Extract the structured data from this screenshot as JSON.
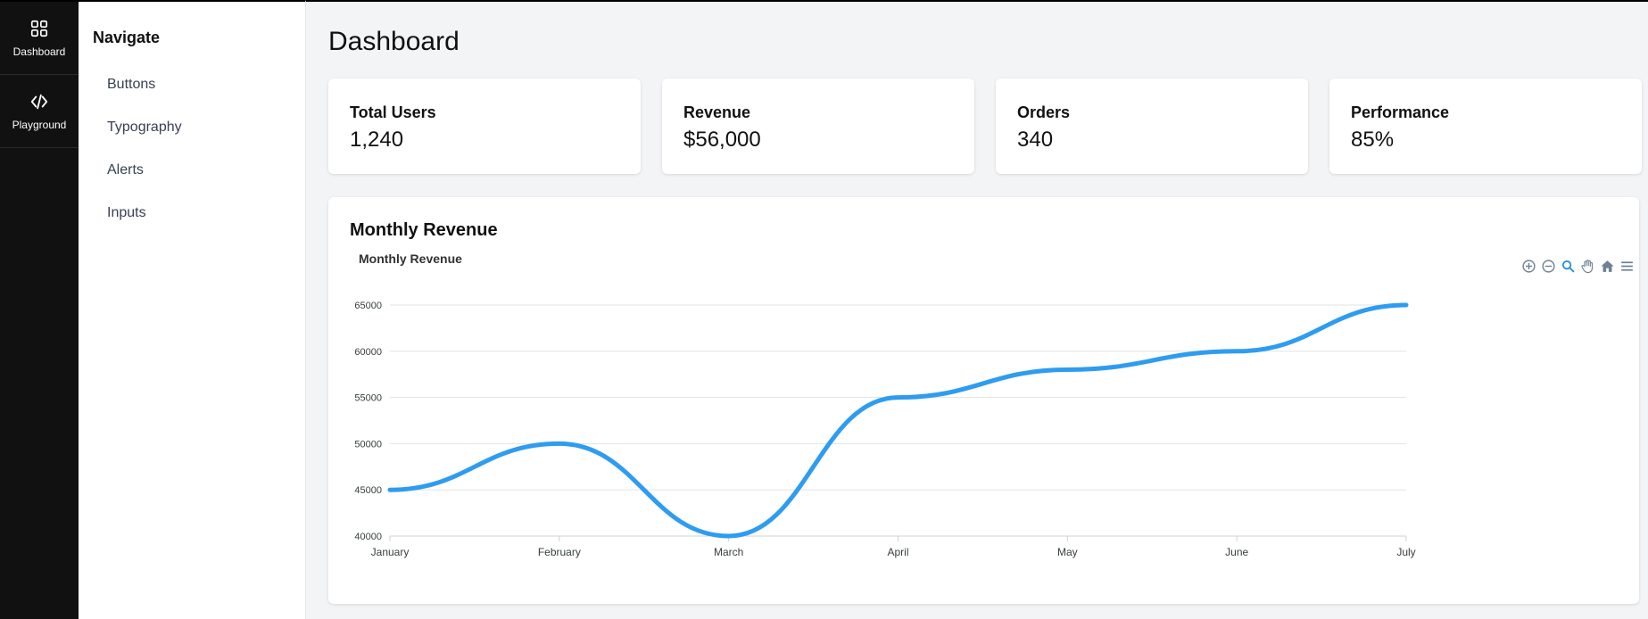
{
  "rail": {
    "items": [
      {
        "label": "Dashboard",
        "icon": "grid-icon"
      },
      {
        "label": "Playground",
        "icon": "code-icon"
      }
    ]
  },
  "sidebar": {
    "title": "Navigate",
    "items": [
      {
        "label": "Buttons"
      },
      {
        "label": "Typography"
      },
      {
        "label": "Alerts"
      },
      {
        "label": "Inputs"
      }
    ]
  },
  "main": {
    "title": "Dashboard",
    "cards": [
      {
        "label": "Total Users",
        "value": "1,240"
      },
      {
        "label": "Revenue",
        "value": "$56,000"
      },
      {
        "label": "Orders",
        "value": "340"
      },
      {
        "label": "Performance",
        "value": "85%"
      }
    ],
    "chart_card_title": "Monthly Revenue"
  },
  "toolbar": {
    "icons": [
      "zoom-in-icon",
      "zoom-out-icon",
      "selection-zoom-icon",
      "pan-icon",
      "home-icon",
      "menu-icon"
    ],
    "active_color": "#1e88e5",
    "inactive_color": "#6e8192"
  },
  "colors": {
    "rail_bg": "#111111",
    "series": "#2e9cf0"
  },
  "chart_data": {
    "type": "line",
    "title": "Monthly Revenue",
    "categories": [
      "January",
      "February",
      "March",
      "April",
      "May",
      "June",
      "July"
    ],
    "series": [
      {
        "values": [
          45000,
          50000,
          40000,
          55000,
          58000,
          60000,
          65000
        ]
      }
    ],
    "ylim": [
      40000,
      65000
    ],
    "yticks": [
      40000,
      45000,
      50000,
      55000,
      60000,
      65000
    ],
    "grid": true,
    "curve": "smooth"
  }
}
